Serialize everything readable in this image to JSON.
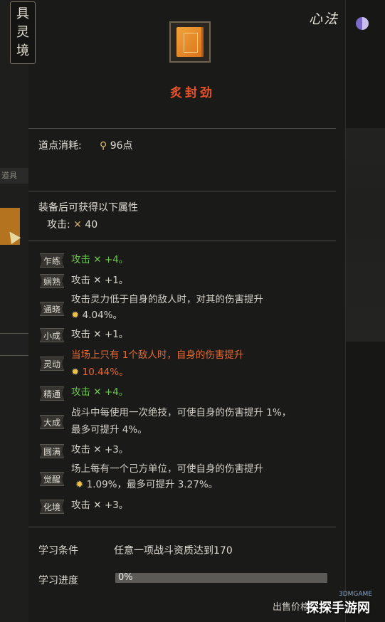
{
  "realm": {
    "chars": [
      "具",
      "灵",
      "境"
    ]
  },
  "header": {
    "mark": "心法",
    "skill_name": "炙封劲"
  },
  "cost": {
    "label": "道点消耗:",
    "value": "96点"
  },
  "equip": {
    "title": "装备后可获得以下属性",
    "attack_label": "攻击:",
    "attack_value": "40"
  },
  "levels": [
    {
      "tag": "乍练",
      "text": "攻击 ✕ +4。",
      "color": "green"
    },
    {
      "tag": "娴熟",
      "text": "攻击 ✕ +1。",
      "color": "normal"
    },
    {
      "tag": "通晓",
      "text": "攻击灵力低于自身的敌人时，对其的伤害提升",
      "text2": "4.04%。",
      "color": "normal"
    },
    {
      "tag": "小成",
      "text": "攻击 ✕ +1。",
      "color": "normal"
    },
    {
      "tag": "灵动",
      "text": "当场上只有 1个敌人时，自身的伤害提升",
      "text2": "10.44%。",
      "color": "orange"
    },
    {
      "tag": "精通",
      "text": "攻击 ✕ +4。",
      "color": "green"
    },
    {
      "tag": "大成",
      "text": "战斗中每使用一次绝技，可使自身的伤害提升 1%，",
      "text2": "最多可提升 4%。",
      "color": "normal"
    },
    {
      "tag": "圆满",
      "text": "攻击 ✕ +3。",
      "color": "normal"
    },
    {
      "tag": "觉醒",
      "text": "场上每有一个己方单位，可使自身的伤害提升",
      "text2": "1.09%，最多可提升 3.27%。",
      "color": "normal"
    },
    {
      "tag": "化境",
      "text": "攻击 ✕ +3。",
      "color": "normal"
    }
  ],
  "learn": {
    "condition_label": "学习条件",
    "condition_value": "任意一项战斗资质达到170",
    "progress_label": "学习进度",
    "progress_text": "0%",
    "progress_fraction": 0.0
  },
  "footer": {
    "sell_label": "出售价格",
    "watermark": "探探手游网",
    "watermark_small": "3DMGAME"
  },
  "side": {
    "tab_text": "道具"
  },
  "colors": {
    "skill_name": "#e5522a",
    "green": "#6cc64a",
    "orange": "#e46a34",
    "sun": "#e9c24a"
  },
  "icons": [
    "pin-icon",
    "sword-icon",
    "sun-icon",
    "taiji-icon",
    "skill-book-icon"
  ]
}
